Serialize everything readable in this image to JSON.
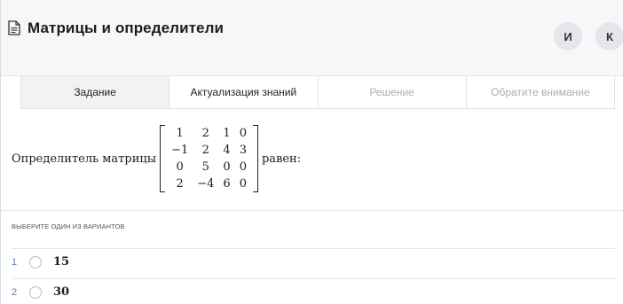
{
  "header": {
    "title": "Матрицы и определители",
    "icon": "document-icon",
    "avatars": [
      "И",
      "К"
    ]
  },
  "tabs": [
    {
      "label": "Задание",
      "state": "active"
    },
    {
      "label": "Актуализация знаний",
      "state": "normal"
    },
    {
      "label": "Решение",
      "state": "disabled"
    },
    {
      "label": "Обратите внимание",
      "state": "disabled"
    }
  ],
  "question": {
    "prefix": "Определитель матрицы",
    "suffix": "равен:",
    "matrix": [
      [
        "1",
        "2",
        "1",
        "0"
      ],
      [
        "−1",
        "2",
        "4",
        "3"
      ],
      [
        "0",
        "5",
        "0",
        "0"
      ],
      [
        "2",
        "−4",
        "6",
        "0"
      ]
    ]
  },
  "answers": {
    "hint": "ВЫБЕРИТЕ ОДИН ИЗ ВАРИАНТОВ",
    "options": [
      {
        "number": "1",
        "value": "15"
      },
      {
        "number": "2",
        "value": "30"
      }
    ]
  }
}
